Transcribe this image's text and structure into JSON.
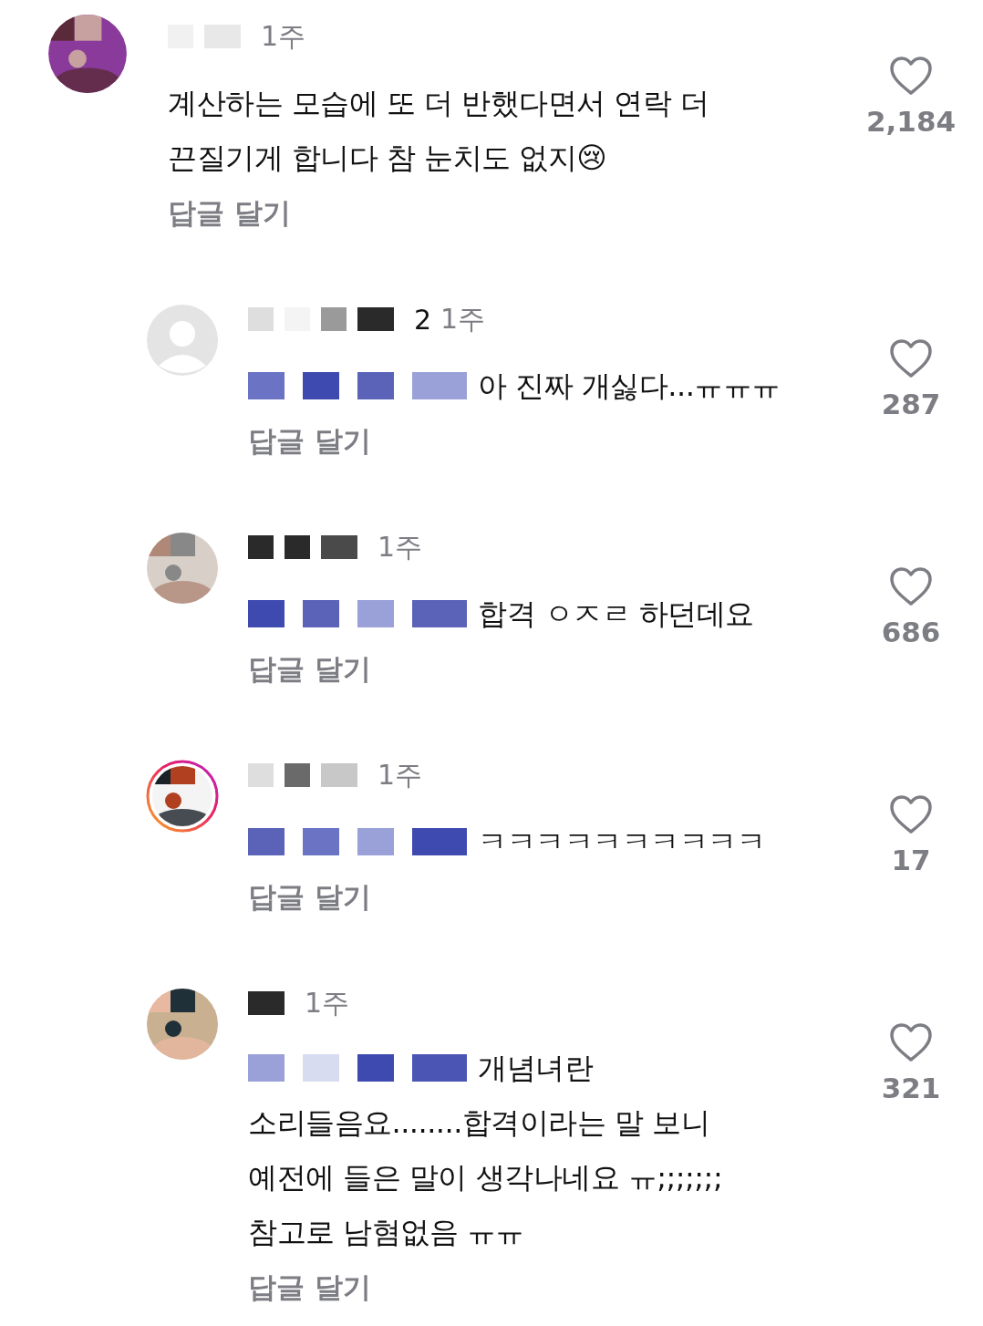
{
  "comments": [
    {
      "kind": "comment",
      "default_avatar": false,
      "time": "1주",
      "lines": [
        "계산하는 모습에 또 더 반했다면서 연락 더",
        "끈질기게 합니다 참 눈치도 없지😢"
      ],
      "reply_label": "답글 달기",
      "likes": "2,184"
    },
    {
      "kind": "reply",
      "default_avatar": true,
      "username_fragment": "2",
      "time": "1주",
      "lines": [
        "아 진짜 개싫다...ㅠㅠㅠ"
      ],
      "reply_label": "답글 달기",
      "likes": "287"
    },
    {
      "kind": "reply",
      "default_avatar": false,
      "time": "1주",
      "lines": [
        "합격 ㅇㅈㄹ 하던데요"
      ],
      "reply_label": "답글 달기",
      "likes": "686"
    },
    {
      "kind": "reply",
      "default_avatar": false,
      "story_ring": true,
      "time": "1주",
      "lines": [
        "ㅋㅋㅋㅋㅋㅋㅋㅋㅋㅋ"
      ],
      "reply_label": "답글 달기",
      "likes": "17"
    },
    {
      "kind": "reply",
      "default_avatar": false,
      "time": "1주",
      "lines": [
        "개념녀란",
        "소리들음요........합격이라는 말 보니",
        "예전에 들은 말이 생각나네요 ㅠ;;;;;;;",
        "참고로 남혐없음 ㅠㅠ"
      ],
      "reply_label": "답글 달기",
      "likes": "321"
    }
  ]
}
